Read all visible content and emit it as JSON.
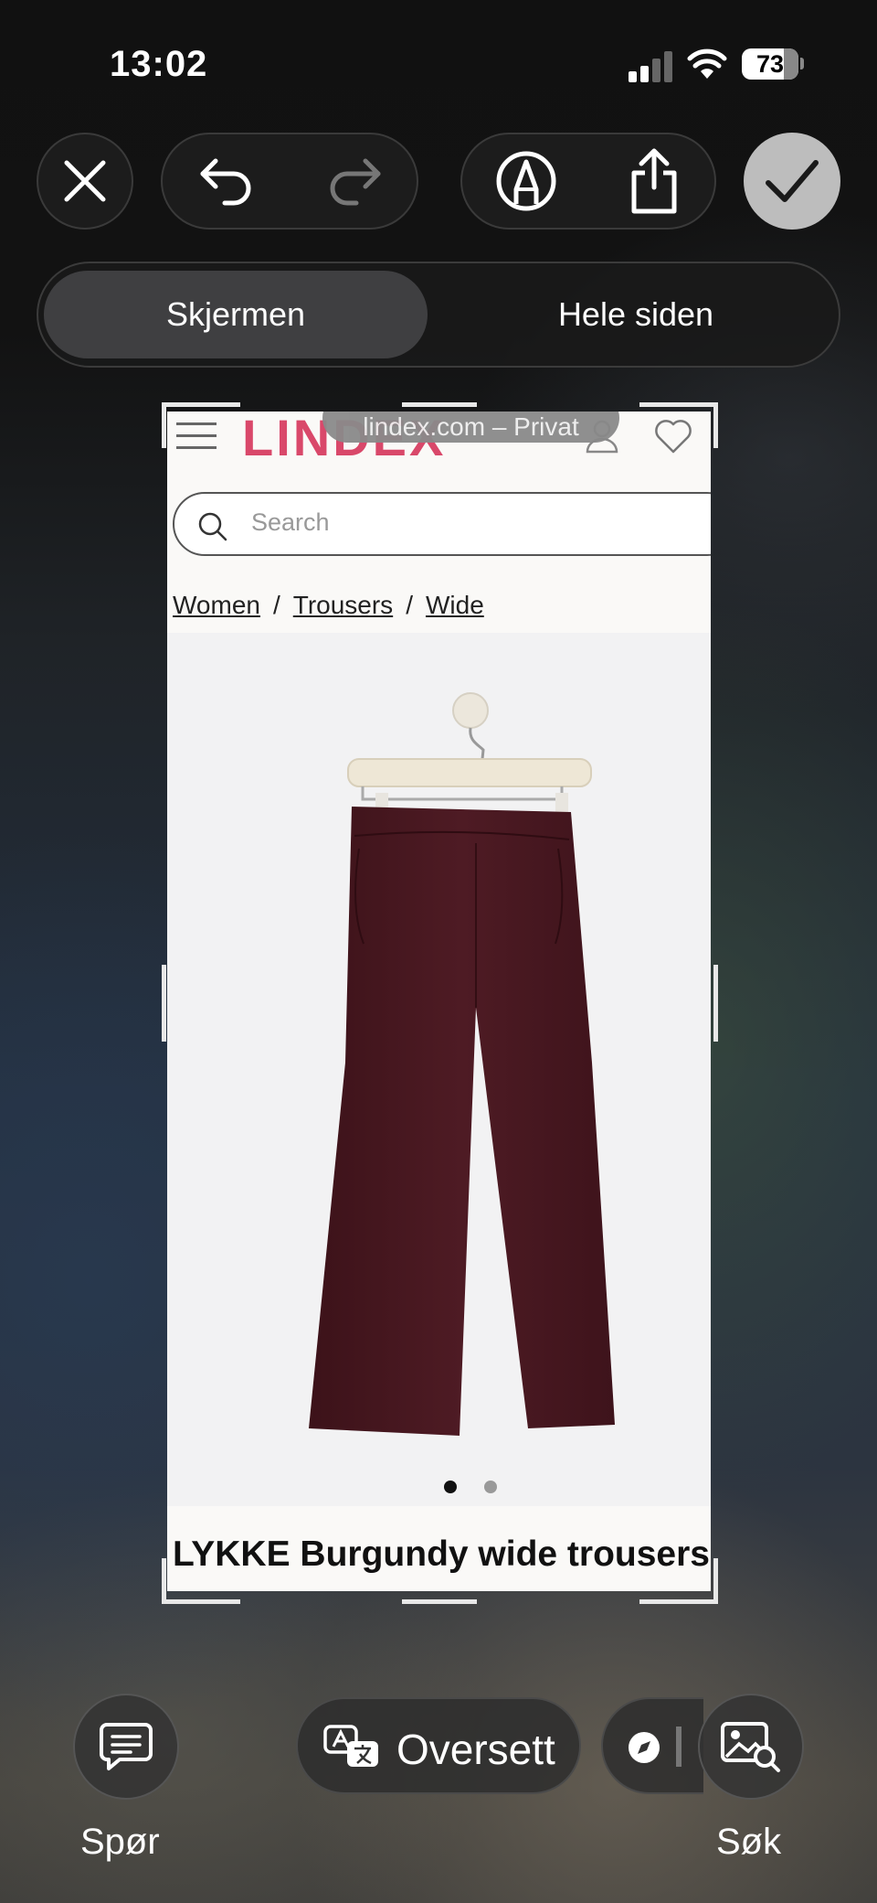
{
  "status_bar": {
    "time": "13:02",
    "battery": "73"
  },
  "toolbar": {
    "close": "close-icon",
    "undo": "undo-icon",
    "redo": "redo-icon",
    "markup": "markup-pen-icon",
    "share": "share-icon",
    "done": "checkmark-icon"
  },
  "segmented": {
    "screen": "Skjermen",
    "full_page": "Hele siden"
  },
  "capture": {
    "url_chip": "lindex.com – Privat",
    "logo": "LINDEX",
    "search_placeholder": "Search",
    "breadcrumb": [
      "Women",
      "Trousers",
      "Wide"
    ],
    "breadcrumb_sep": "/",
    "product_title": "LYKKE Burgundy wide trousers",
    "colors": {
      "logo": "#d9486a",
      "trousers": "#4a1a22"
    }
  },
  "bottom_bar": {
    "ask_label": "Spør",
    "translate_label": "Oversett",
    "search_label": "Søk"
  }
}
